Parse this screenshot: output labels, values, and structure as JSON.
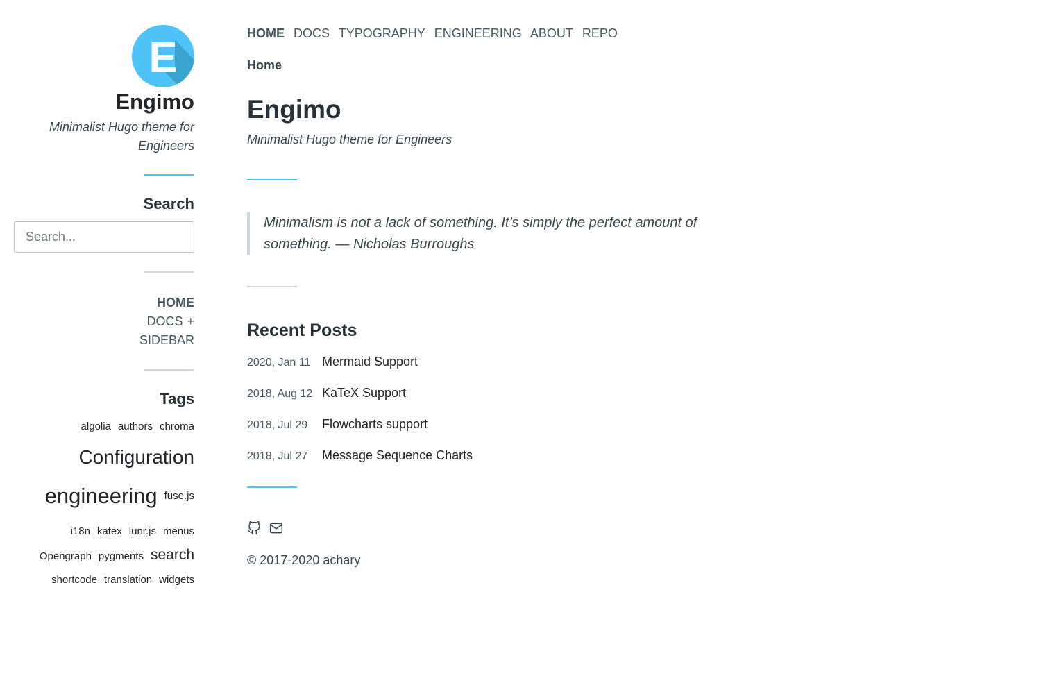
{
  "site": {
    "title": "Engimo",
    "description": "Minimalist Hugo theme for Engineers",
    "logo_letter": "E",
    "accent_color": "#4fc3f7"
  },
  "sidebar": {
    "search_heading": "Search",
    "search_placeholder": "Search...",
    "menu": [
      {
        "label": "HOME",
        "active": true
      },
      {
        "label": "DOCS",
        "expand_glyph": "+"
      },
      {
        "label": "SIDEBAR"
      }
    ],
    "tags_heading": "Tags",
    "tags": [
      "algolia",
      "authors",
      "chroma",
      "Configuration",
      "engineering",
      "fuse.js",
      "i18n",
      "katex",
      "lunr.js",
      "menus",
      "Opengraph",
      "pygments",
      "search",
      "shortcode",
      "translation",
      "widgets"
    ]
  },
  "topnav": [
    "HOME",
    "DOCS",
    "TYPOGRAPHY",
    "ENGINEERING",
    "ABOUT",
    "REPO"
  ],
  "breadcrumb": "Home",
  "page": {
    "title": "Engimo",
    "subtitle": "Minimalist Hugo theme for Engineers",
    "quote": "Minimalism is not a lack of something. It’s simply the perfect amount of something. — Nicholas Burroughs"
  },
  "recent_posts": {
    "heading": "Recent Posts",
    "items": [
      {
        "date": "2020, Jan 11",
        "title": "Mermaid Support"
      },
      {
        "date": "2018, Aug 12",
        "title": "KaTeX Support"
      },
      {
        "date": "2018, Jul 29",
        "title": "Flowcharts support"
      },
      {
        "date": "2018, Jul 27",
        "title": "Message Sequence Charts"
      }
    ]
  },
  "footer": {
    "icons": [
      "github-icon",
      "mail-icon"
    ],
    "copyright": "© 2017-2020 achary"
  }
}
